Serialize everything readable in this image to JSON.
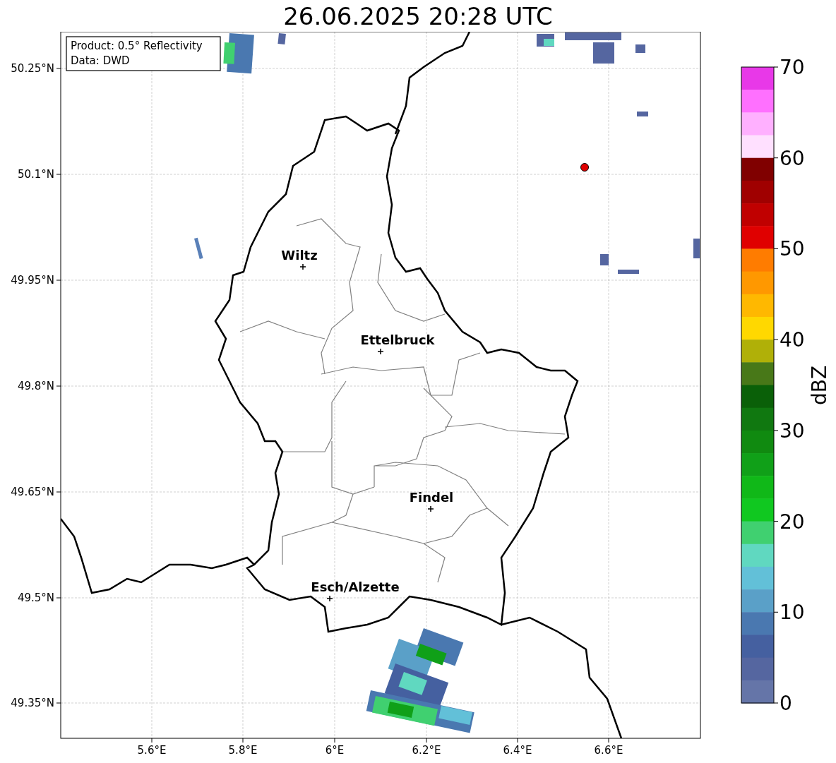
{
  "title": "26.06.2025 20:28 UTC",
  "annotation": [
    "Product: 0.5° Reflectivity",
    "Data: DWD"
  ],
  "map": {
    "lat_ticks": [
      "50.25°N",
      "50.1°N",
      "49.95°N",
      "49.8°N",
      "49.65°N",
      "49.5°N",
      "49.35°N"
    ],
    "lon_ticks": [
      "5.6°E",
      "5.8°E",
      "6°E",
      "6.2°E",
      "6.4°E",
      "6.6°E"
    ],
    "cities": [
      {
        "name": "Wiltz"
      },
      {
        "name": "Ettelbruck"
      },
      {
        "name": "Findel"
      },
      {
        "name": "Esch/Alzette"
      }
    ]
  },
  "colorbar": {
    "label": "dBZ",
    "ticks": [
      "70",
      "60",
      "50",
      "40",
      "30",
      "20",
      "10",
      "0"
    ],
    "bins": [
      {
        "color": "#e838e8"
      },
      {
        "color": "#ff70ff"
      },
      {
        "color": "#ffb0ff"
      },
      {
        "color": "#ffe0ff"
      },
      {
        "color": "#800000"
      },
      {
        "color": "#a00000"
      },
      {
        "color": "#c00000"
      },
      {
        "color": "#e00000"
      },
      {
        "color": "#ff7c00"
      },
      {
        "color": "#ff9800"
      },
      {
        "color": "#ffb800"
      },
      {
        "color": "#ffd800"
      },
      {
        "color": "#b0b008"
      },
      {
        "color": "#487818"
      },
      {
        "color": "#0a6008"
      },
      {
        "color": "#107810"
      },
      {
        "color": "#108a10"
      },
      {
        "color": "#10a018"
      },
      {
        "color": "#10b818"
      },
      {
        "color": "#10c820"
      },
      {
        "color": "#40d070"
      },
      {
        "color": "#60d8c0"
      },
      {
        "color": "#62c0d8"
      },
      {
        "color": "#5aa0c8"
      },
      {
        "color": "#4a78b0"
      },
      {
        "color": "#4560a0"
      },
      {
        "color": "#5566a0"
      },
      {
        "color": "#6575a8"
      }
    ]
  }
}
